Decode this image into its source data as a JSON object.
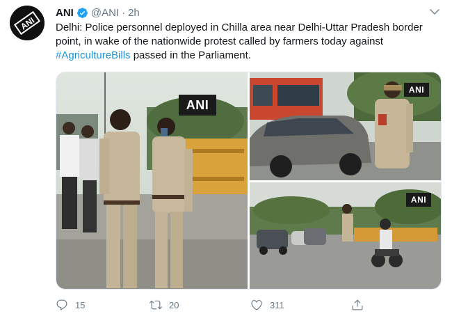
{
  "tweet": {
    "author_name": "ANI",
    "handle": "@ANI",
    "separator": "·",
    "time": "2h",
    "text_before": "Delhi: Police personnel deployed in Chilla area near Delhi-Uttar Pradesh border point, in wake of the nationwide protest called by farmers today against ",
    "hashtag": "#AgricultureBills",
    "text_after": " passed in the Parliament.",
    "verified": true
  },
  "media": {
    "watermark": "ANI",
    "photos": [
      "police-officers-photo",
      "officer-directing-traffic-photo",
      "road-checkpoint-photo"
    ]
  },
  "actions": {
    "reply_count": "15",
    "retweet_count": "20",
    "like_count": "311"
  },
  "colors": {
    "text": "#14171a",
    "secondary": "#657786",
    "link": "#1b95e0",
    "verified": "#1da1f2"
  },
  "icons": [
    "ani-logo",
    "verified-badge-icon",
    "chevron-down-icon",
    "reply-icon",
    "retweet-icon",
    "like-icon",
    "share-icon"
  ]
}
